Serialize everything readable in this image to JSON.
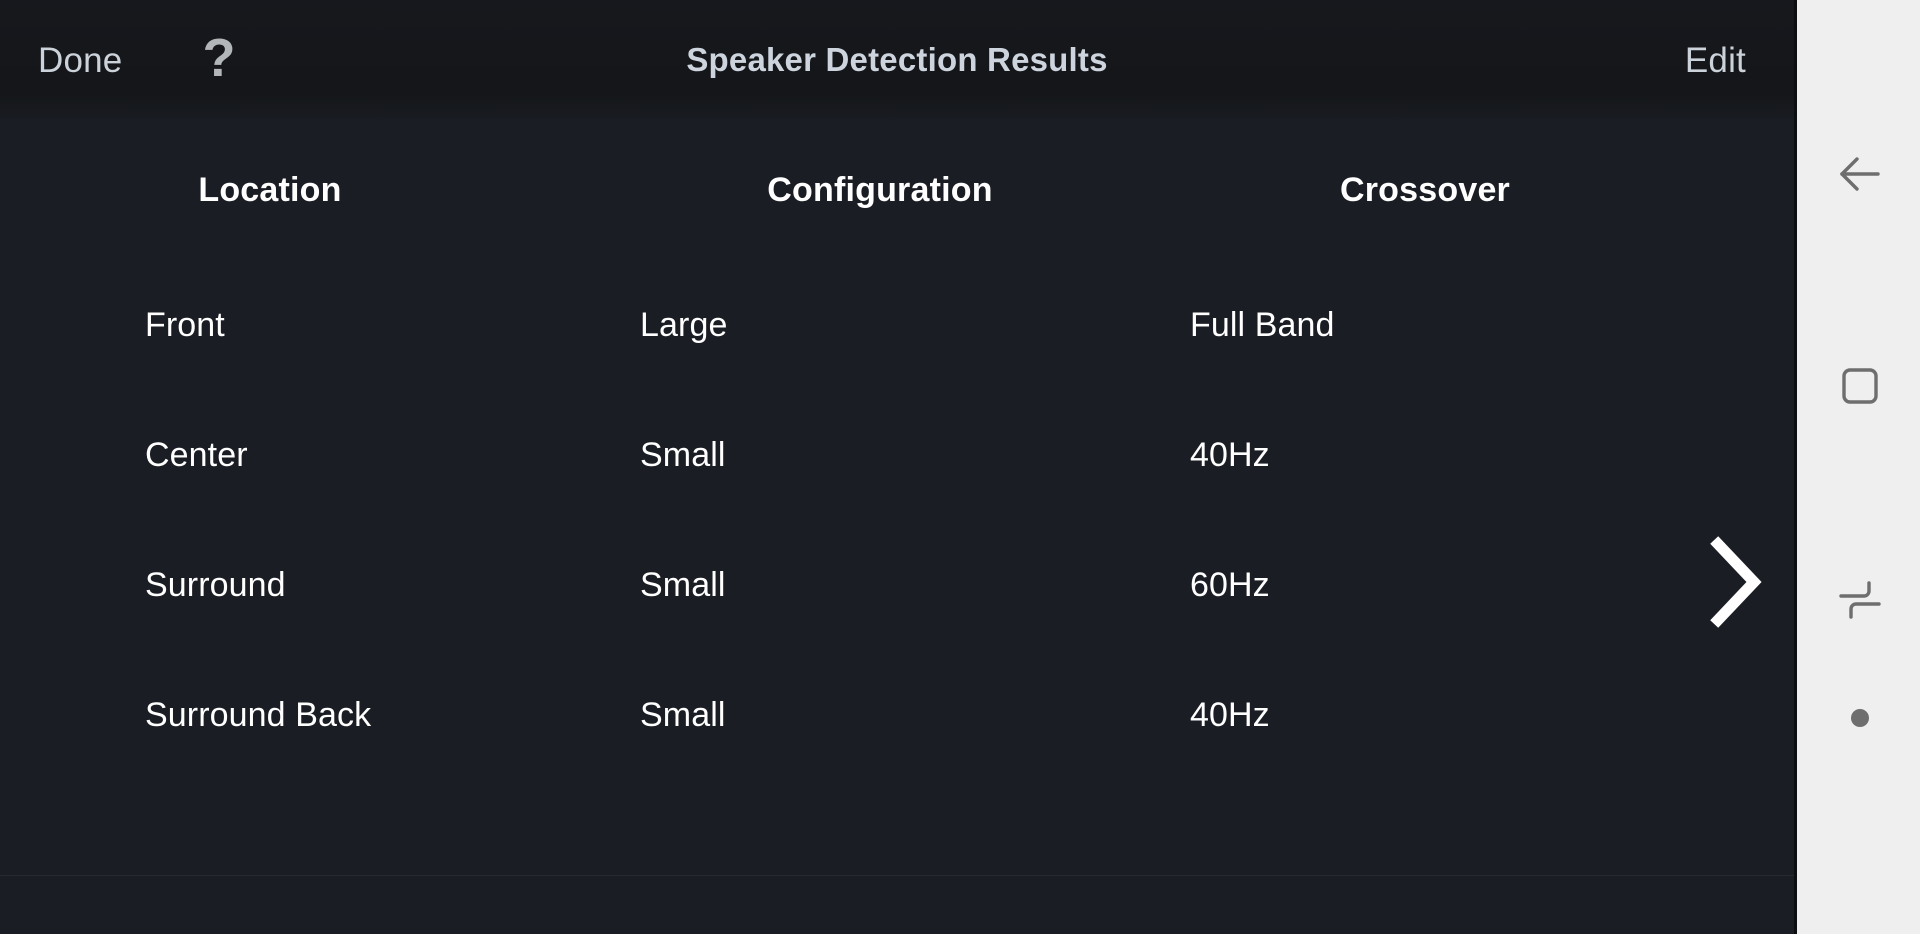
{
  "header": {
    "done_label": "Done",
    "help_icon": "question-mark-icon",
    "help_glyph": "?",
    "title": "Speaker Detection Results",
    "edit_label": "Edit"
  },
  "table": {
    "columns": [
      "Location",
      "Configuration",
      "Crossover"
    ],
    "rows": [
      {
        "location": "Front",
        "configuration": "Large",
        "crossover": "Full Band"
      },
      {
        "location": "Center",
        "configuration": "Small",
        "crossover": "40Hz"
      },
      {
        "location": "Surround",
        "configuration": "Small",
        "crossover": "60Hz"
      },
      {
        "location": "Surround Back",
        "configuration": "Small",
        "crossover": "40Hz"
      }
    ]
  },
  "pager": {
    "next_icon": "chevron-right-icon"
  },
  "system_navbar": {
    "buttons": [
      {
        "name": "back-icon"
      },
      {
        "name": "recents-square-icon"
      },
      {
        "name": "split-screen-icon"
      },
      {
        "name": "dot-indicator-icon"
      }
    ]
  },
  "colors": {
    "panel_background": "#1a1d24",
    "header_background": "#15171b",
    "header_text": "#cdd4dd",
    "action_text": "#ccd2da",
    "body_text": "#ffffff",
    "navbar_background": "#efeff0",
    "navbar_icon": "#6e6e6e"
  }
}
